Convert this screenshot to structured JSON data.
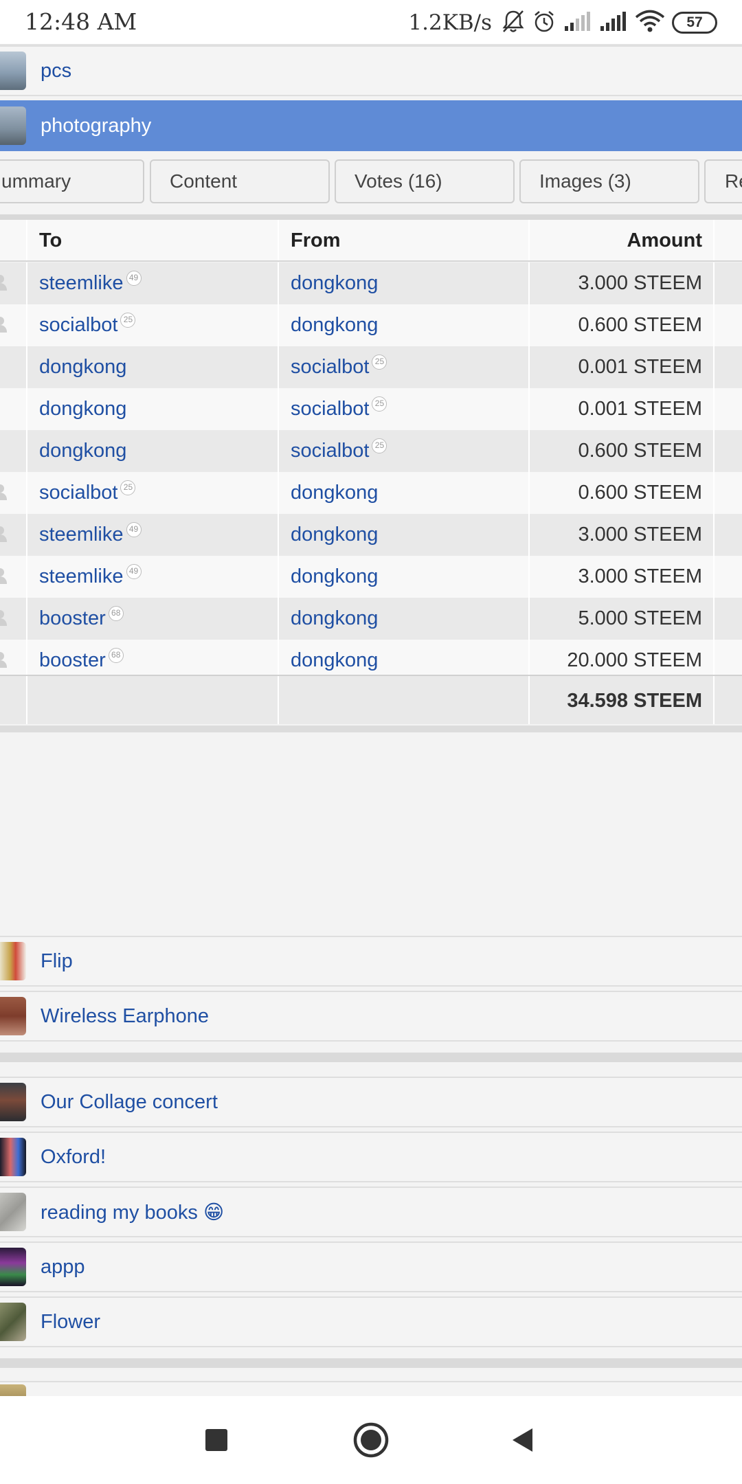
{
  "status_bar": {
    "time": "12:48 AM",
    "net_speed": "1.2KB/s",
    "battery": "57",
    "icons": [
      "bell-off-icon",
      "alarm-icon",
      "signal-icon",
      "signal-icon",
      "wifi-icon",
      "battery-icon"
    ]
  },
  "top_list": [
    {
      "label": "pcs",
      "active": false
    },
    {
      "label": "photography",
      "active": true
    }
  ],
  "tabs": [
    "ummary",
    "Content",
    "Votes (16)",
    "Images (3)",
    "Re"
  ],
  "table": {
    "headers": {
      "to": "To",
      "from": "From",
      "amount": "Amount"
    },
    "rows": [
      {
        "to": "steemlike",
        "to_rep": "49",
        "from": "dongkong",
        "from_rep": "",
        "amount": "3.000 STEEM"
      },
      {
        "to": "socialbot",
        "to_rep": "25",
        "from": "dongkong",
        "from_rep": "",
        "amount": "0.600 STEEM"
      },
      {
        "to": "dongkong",
        "to_rep": "",
        "from": "socialbot",
        "from_rep": "25",
        "amount": "0.001 STEEM"
      },
      {
        "to": "dongkong",
        "to_rep": "",
        "from": "socialbot",
        "from_rep": "25",
        "amount": "0.001 STEEM"
      },
      {
        "to": "dongkong",
        "to_rep": "",
        "from": "socialbot",
        "from_rep": "25",
        "amount": "0.600 STEEM"
      },
      {
        "to": "socialbot",
        "to_rep": "25",
        "from": "dongkong",
        "from_rep": "",
        "amount": "0.600 STEEM"
      },
      {
        "to": "steemlike",
        "to_rep": "49",
        "from": "dongkong",
        "from_rep": "",
        "amount": "3.000 STEEM"
      },
      {
        "to": "steemlike",
        "to_rep": "49",
        "from": "dongkong",
        "from_rep": "",
        "amount": "3.000 STEEM"
      },
      {
        "to": "booster",
        "to_rep": "68",
        "from": "dongkong",
        "from_rep": "",
        "amount": "5.000 STEEM"
      },
      {
        "to": "booster",
        "to_rep": "68",
        "from": "dongkong",
        "from_rep": "",
        "amount": "20.000 STEEM"
      }
    ],
    "total": "34.598 STEEM"
  },
  "post_list_1": [
    {
      "label": "Flip"
    },
    {
      "label": "Wireless Earphone"
    }
  ],
  "post_list_2": [
    {
      "label": "Our Collage concert"
    },
    {
      "label": "Oxford!"
    },
    {
      "label": "reading my books 😁"
    },
    {
      "label": "appp"
    },
    {
      "label": "Flower"
    }
  ],
  "nav": {
    "icons": [
      "recents-square-icon",
      "home-circle-icon",
      "back-triangle-icon"
    ]
  }
}
